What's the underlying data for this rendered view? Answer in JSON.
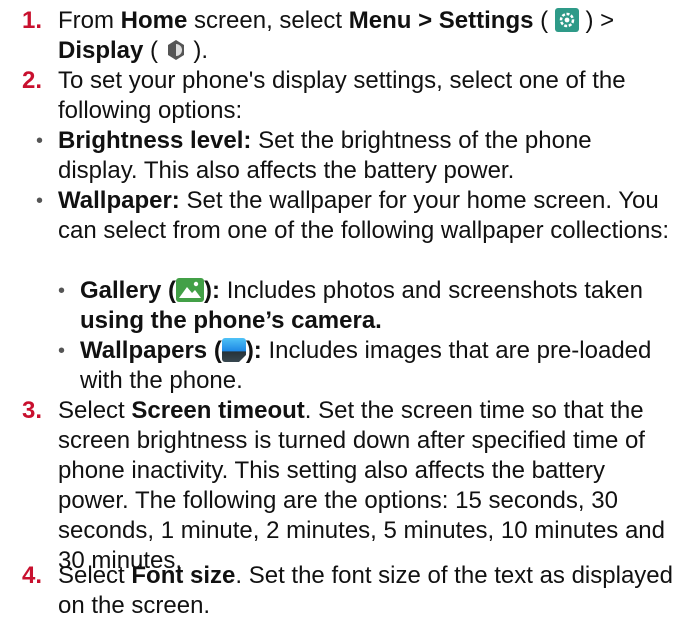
{
  "steps": [
    {
      "num": "1.",
      "a": "From ",
      "b1": "Home",
      "c": " screen, select ",
      "b2": "Menu > Settings",
      "d": " (",
      "e": ") >",
      "b3": "Display",
      "f": " (",
      "g": ")."
    },
    {
      "num": "2.",
      "text": "To set your phone's display settings, select one of the following options:"
    },
    {
      "num": "3.",
      "a": "Select ",
      "b": "Screen timeout",
      "c": ". Set the screen time so that the screen brightness is turned down after specified time of phone inactivity. This setting also affects the battery power. The following are the options: 15 seconds, 30 seconds, 1 minute, 2 minutes, 5 minutes, 10 minutes and 30 minutes."
    },
    {
      "num": "4.",
      "a": "Select ",
      "b": "Font size",
      "c": ". Set the font size of the text as displayed on the screen."
    }
  ],
  "options": {
    "brightness": {
      "label": "Brightness level:",
      "text": " Set the brightness of the phone display. This also affects the battery power."
    },
    "wallpaper": {
      "label": "Wallpaper:",
      "text": "  Set the wallpaper for your home screen. You can select from one of the following wallpaper collections:"
    },
    "gallery": {
      "label": "Gallery (",
      "label_end": "):",
      "text": " Includes photos and screenshots taken ",
      "bold_end": "using the phone’s camera."
    },
    "wallpapers": {
      "label": "Wallpapers (",
      "label_end": "):",
      "text": " Includes images that are pre-loaded with the phone."
    }
  },
  "bullet": "•",
  "icons": {
    "settings": "settings-gear-icon",
    "display": "display-brightness-icon",
    "gallery": "gallery-photo-icon",
    "wallpapers": "wallpaper-image-icon"
  },
  "colors": {
    "step_number": "#c8102e",
    "text": "#111111"
  }
}
